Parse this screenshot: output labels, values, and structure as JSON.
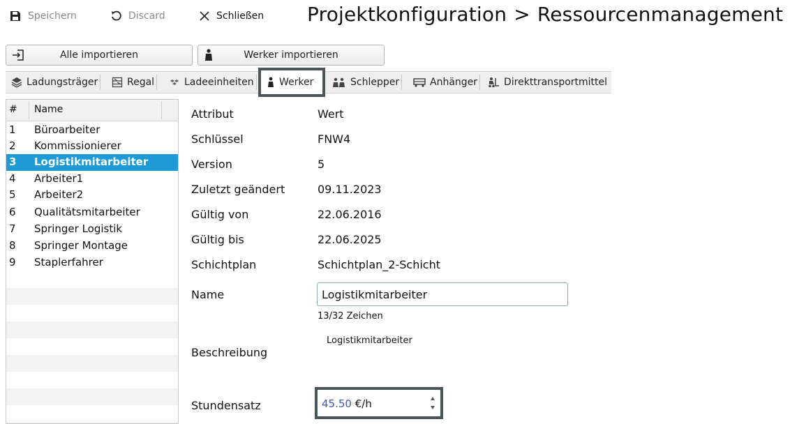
{
  "toolbar": {
    "save_label": "Speichern",
    "discard_label": "Discard",
    "close_label": "Schließen"
  },
  "title": {
    "part1": "Projektkonfiguration",
    "separator": ">",
    "part2": "Ressourcenmanagement"
  },
  "import": {
    "all_label": "Alle importieren",
    "werker_label": "Werker importieren"
  },
  "tabs": [
    {
      "label": "Ladungsträger",
      "icon": "stack-icon"
    },
    {
      "label": "Regal",
      "icon": "shelf-icon"
    },
    {
      "label": "Ladeeinheiten",
      "icon": "boxes-icon"
    },
    {
      "label": "Werker",
      "icon": "worker-icon"
    },
    {
      "label": "Schlepper",
      "icon": "tug-icon"
    },
    {
      "label": "Anhänger",
      "icon": "trailer-icon"
    },
    {
      "label": "Direkttransportmittel",
      "icon": "forklift-icon"
    }
  ],
  "active_tab": "Werker",
  "list": {
    "header_num": "#",
    "header_name": "Name",
    "rows": [
      {
        "num": "1",
        "name": "Büroarbeiter"
      },
      {
        "num": "2",
        "name": "Kommissionierer"
      },
      {
        "num": "3",
        "name": "Logistikmitarbeiter"
      },
      {
        "num": "4",
        "name": "Arbeiter1"
      },
      {
        "num": "5",
        "name": "Arbeiter2"
      },
      {
        "num": "6",
        "name": "Qualitätsmitarbeiter"
      },
      {
        "num": "7",
        "name": "Springer Logistik"
      },
      {
        "num": "8",
        "name": "Springer Montage"
      },
      {
        "num": "9",
        "name": "Staplerfahrer"
      }
    ],
    "selected_num": "3"
  },
  "details": {
    "header_attr": "Attribut",
    "header_value": "Wert",
    "key_label": "Schlüssel",
    "key_value": "FNW4",
    "version_label": "Version",
    "version_value": "5",
    "changed_label": "Zuletzt geändert",
    "changed_value": "09.11.2023",
    "valid_from_label": "Gültig von",
    "valid_from_value": "22.06.2016",
    "valid_to_label": "Gültig bis",
    "valid_to_value": "22.06.2025",
    "shift_label": "Schichtplan",
    "shift_value": "Schichtplan_2-Schicht",
    "name_label": "Name",
    "name_value": "Logistikmitarbeiter",
    "name_counter": "13/32 Zeichen",
    "desc_label": "Beschreibung",
    "desc_value": "Logistikmitarbeiter",
    "rate_label": "Stundensatz",
    "rate_value": "45.50",
    "rate_unit": "€/h"
  },
  "colors": {
    "selection": "#1e9ad6",
    "highlight_border": "#4a5558"
  }
}
